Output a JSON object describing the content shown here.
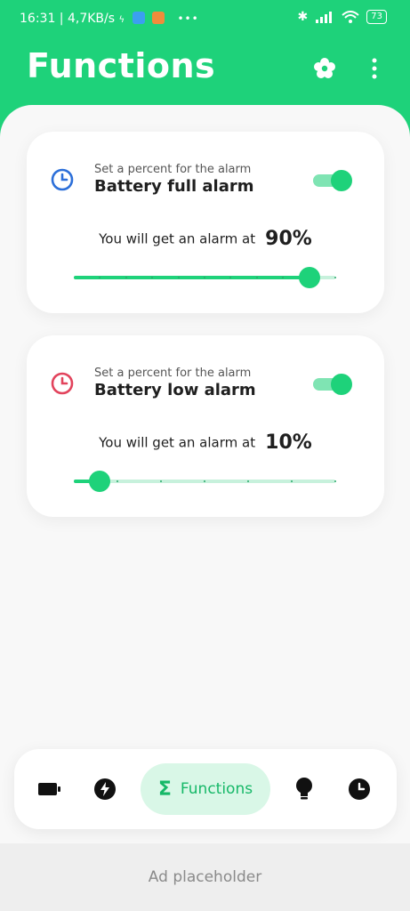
{
  "status_bar": {
    "time": "16:31",
    "speed": "4,7KB/s",
    "battery": "73"
  },
  "header": {
    "title": "Functions",
    "settings_icon": "flower-gear-icon",
    "menu_icon": "more-vertical-icon"
  },
  "cards": [
    {
      "subtitle": "Set a percent for the alarm",
      "title": "Battery full alarm",
      "icon": "clock-icon",
      "icon_color": "#2c6fd9",
      "enabled": true,
      "alarm_text": "You will get an alarm at",
      "percent_label": "90%",
      "percent": 90,
      "ticks": 10
    },
    {
      "subtitle": "Set a percent for the alarm",
      "title": "Battery low alarm",
      "icon": "clock-icon",
      "icon_color": "#e2435c",
      "enabled": true,
      "alarm_text": "You will get an alarm at",
      "percent_label": "10%",
      "percent": 10,
      "ticks": 6
    }
  ],
  "bottom_nav": {
    "items": [
      "battery-icon",
      "bolt-icon",
      "functions-tab",
      "bulb-icon",
      "clock-icon"
    ],
    "active_label": "Functions"
  },
  "ad": {
    "label": "Ad placeholder"
  },
  "colors": {
    "accent": "#1ed27a",
    "accent_light": "#7fe4b3",
    "track_light": "#c7f1dc",
    "active_tab_bg": "#d9f7e7"
  }
}
